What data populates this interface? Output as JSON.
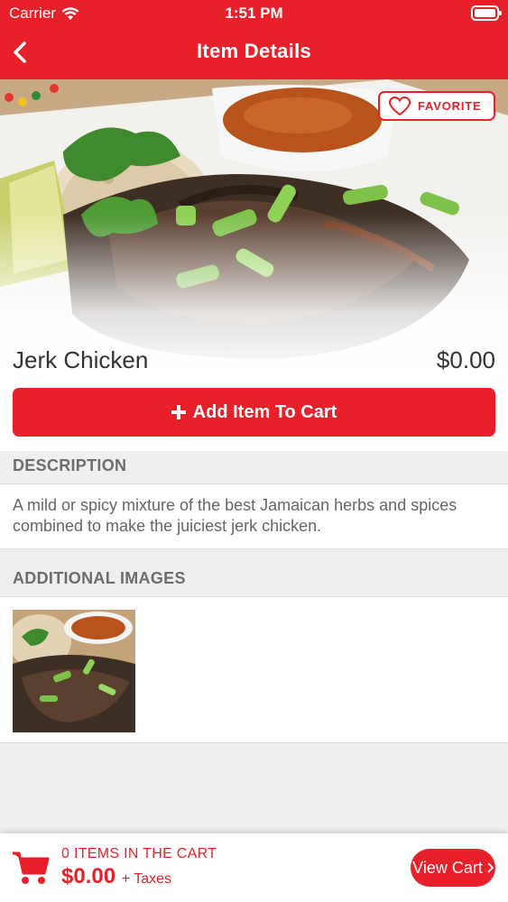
{
  "status": {
    "carrier": "Carrier",
    "time": "1:51 PM"
  },
  "nav": {
    "title": "Item Details"
  },
  "favorite": {
    "label": "FAVORITE"
  },
  "item": {
    "name": "Jerk Chicken",
    "price": "$0.00"
  },
  "add_button": {
    "label": "Add Item To Cart"
  },
  "description": {
    "heading": "DESCRIPTION",
    "text": "A mild or spicy mixture of the best Jamaican herbs and spices combined to make the juiciest jerk chicken."
  },
  "additional_images": {
    "heading": "ADDITIONAL IMAGES"
  },
  "cart": {
    "count_label": "0 ITEMS IN THE CART",
    "total": "$0.00",
    "taxes": "+ Taxes",
    "view_label": "View Cart"
  },
  "colors": {
    "brand": "#e8202a"
  }
}
